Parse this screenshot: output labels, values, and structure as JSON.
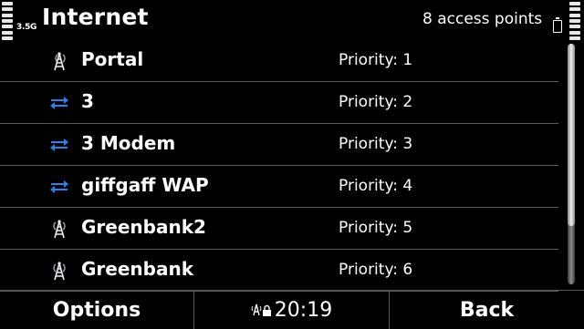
{
  "status": {
    "network_type": "3.5G",
    "title": "Internet",
    "access_points_count": "8 access points"
  },
  "list": {
    "items": [
      {
        "name": "Portal",
        "priority": "Priority: 1",
        "type": "tower-icon"
      },
      {
        "name": "3",
        "priority": "Priority: 2",
        "type": "packet-data-icon"
      },
      {
        "name": "3 Modem",
        "priority": "Priority: 3",
        "type": "packet-data-icon"
      },
      {
        "name": "giffgaff WAP",
        "priority": "Priority: 4",
        "type": "packet-data-icon"
      },
      {
        "name": "Greenbank2",
        "priority": "Priority: 5",
        "type": "tower-icon"
      },
      {
        "name": "Greenbank",
        "priority": "Priority: 6",
        "type": "tower-icon"
      }
    ]
  },
  "softkeys": {
    "left": "Options",
    "clock": "20:19",
    "right": "Back"
  },
  "colors": {
    "background": "#000000",
    "text": "#ffffff",
    "divider": "#5a5a5a",
    "packet_data_blue": "#2f7fe8"
  }
}
